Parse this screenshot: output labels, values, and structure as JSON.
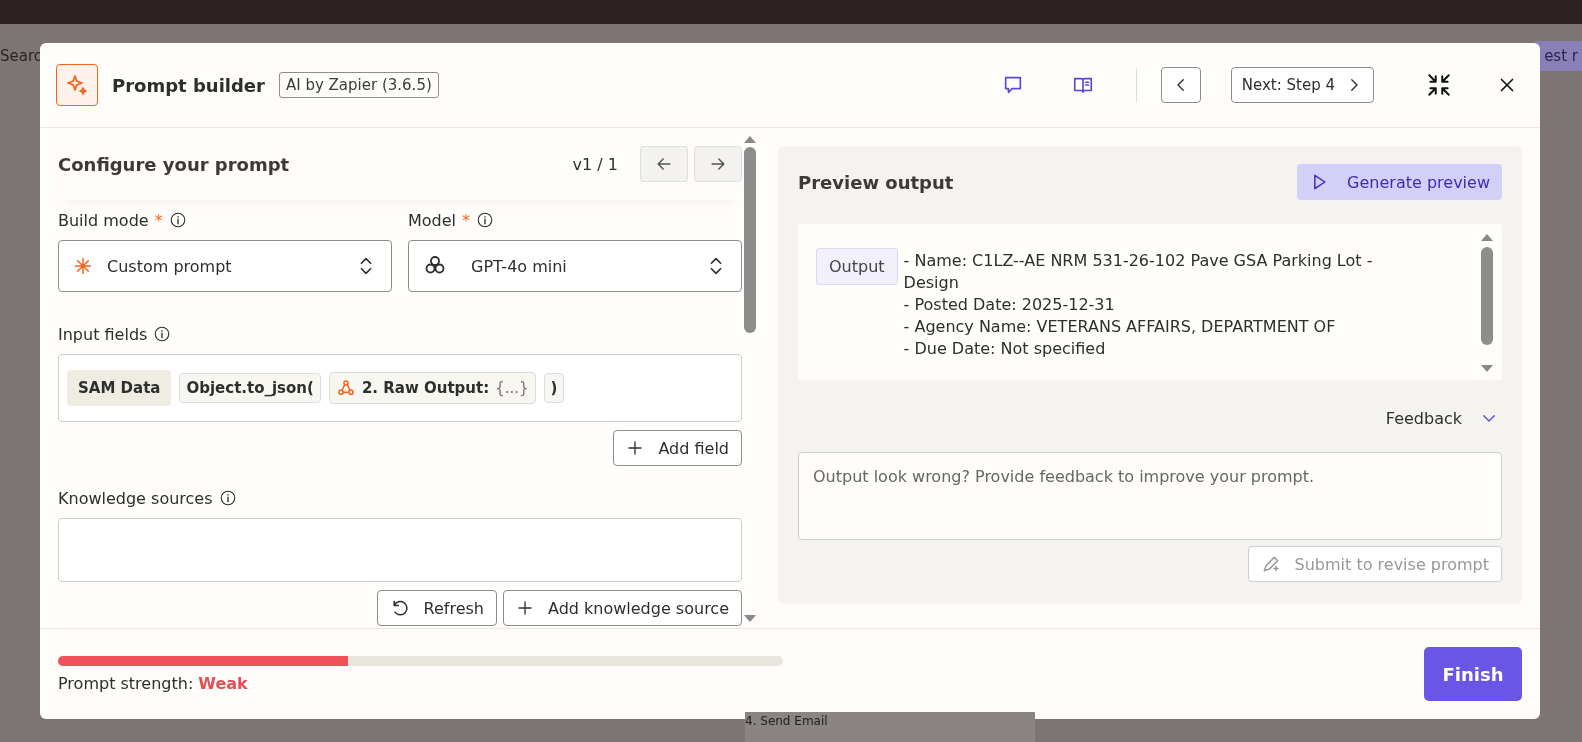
{
  "backdrop": {
    "search_text": "Searc",
    "button_text": "est r",
    "step_text": "4. Send Email"
  },
  "header": {
    "title": "Prompt builder",
    "badge": "AI by Zapier (3.6.5)",
    "next_button": "Next: Step 4"
  },
  "configure": {
    "heading": "Configure your prompt",
    "version": "v1 / 1",
    "build_mode": {
      "label": "Build mode",
      "required": "*",
      "value": "Custom prompt"
    },
    "model": {
      "label": "Model",
      "required": "*",
      "value": "GPT-4o mini"
    },
    "input_fields": {
      "label": "Input fields",
      "tokens": [
        {
          "kind": "label",
          "text": "SAM Data"
        },
        {
          "kind": "code",
          "text": "Object.to_json("
        },
        {
          "kind": "step",
          "text": "2. Raw Output:",
          "value": "{...}"
        },
        {
          "kind": "code",
          "text": ")"
        }
      ]
    },
    "add_field": "Add field",
    "knowledge": {
      "label": "Knowledge sources"
    },
    "refresh": "Refresh",
    "add_knowledge": "Add knowledge source"
  },
  "preview": {
    "heading": "Preview output",
    "generate": "Generate preview",
    "output_label": "Output",
    "output_lines": [
      "- Name: C1LZ--AE NRM 531-26-102 Pave GSA Parking Lot - Design",
      "- Posted Date: 2025-12-31",
      "- Agency Name: VETERANS AFFAIRS, DEPARTMENT OF",
      "- Due Date: Not specified"
    ],
    "feedback": {
      "label": "Feedback",
      "expanded": true,
      "placeholder": "Output look wrong? Provide feedback to improve your prompt."
    },
    "submit": {
      "label": "Submit to revise prompt",
      "disabled": true
    }
  },
  "footer": {
    "strength": {
      "level": 0.4,
      "label": "Prompt strength:",
      "value": "Weak"
    },
    "finish": "Finish"
  }
}
